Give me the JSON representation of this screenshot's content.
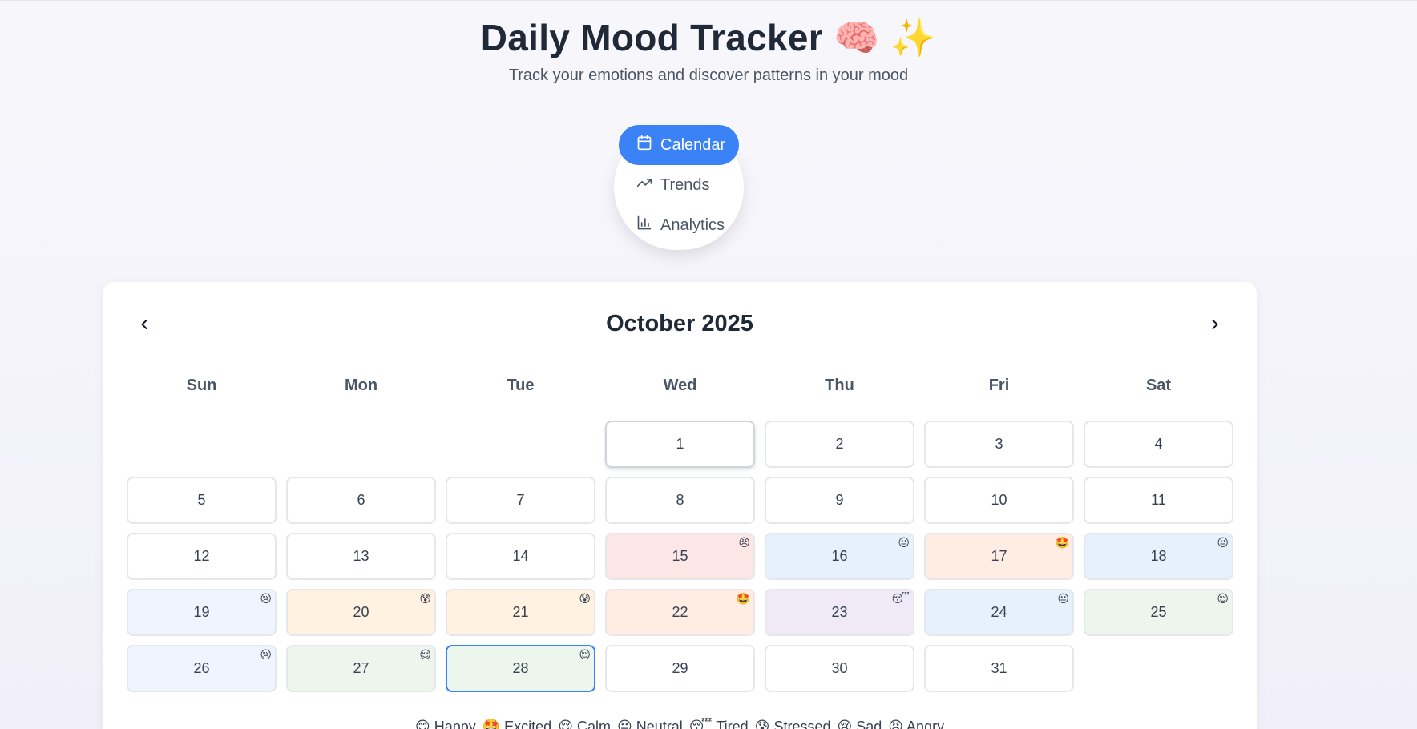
{
  "header": {
    "title": "Daily Mood Tracker 🧠 ✨",
    "subtitle": "Track your emotions and discover patterns in your mood"
  },
  "nav": {
    "items": [
      {
        "label": "Calendar",
        "icon": "calendar-icon",
        "active": true
      },
      {
        "label": "Trends",
        "icon": "trending-up-icon",
        "active": false
      },
      {
        "label": "Analytics",
        "icon": "bar-chart-icon",
        "active": false
      }
    ]
  },
  "calendar": {
    "month_label": "October 2025",
    "weekdays": [
      "Sun",
      "Mon",
      "Tue",
      "Wed",
      "Thu",
      "Fri",
      "Sat"
    ],
    "first_weekday_index": 3,
    "today": 1,
    "selected": 28,
    "days": [
      {
        "day": "1",
        "mood": null
      },
      {
        "day": "2",
        "mood": null
      },
      {
        "day": "3",
        "mood": null
      },
      {
        "day": "4",
        "mood": null
      },
      {
        "day": "5",
        "mood": null
      },
      {
        "day": "6",
        "mood": null
      },
      {
        "day": "7",
        "mood": null
      },
      {
        "day": "8",
        "mood": null
      },
      {
        "day": "9",
        "mood": null
      },
      {
        "day": "10",
        "mood": null
      },
      {
        "day": "11",
        "mood": null
      },
      {
        "day": "12",
        "mood": null
      },
      {
        "day": "13",
        "mood": null
      },
      {
        "day": "14",
        "mood": null
      },
      {
        "day": "15",
        "mood": "angry"
      },
      {
        "day": "16",
        "mood": "neutral"
      },
      {
        "day": "17",
        "mood": "excited"
      },
      {
        "day": "18",
        "mood": "neutral"
      },
      {
        "day": "19",
        "mood": "sad"
      },
      {
        "day": "20",
        "mood": "stressed"
      },
      {
        "day": "21",
        "mood": "stressed"
      },
      {
        "day": "22",
        "mood": "excited"
      },
      {
        "day": "23",
        "mood": "tired"
      },
      {
        "day": "24",
        "mood": "neutral"
      },
      {
        "day": "25",
        "mood": "calm"
      },
      {
        "day": "26",
        "mood": "sad"
      },
      {
        "day": "27",
        "mood": "calm"
      },
      {
        "day": "28",
        "mood": "calm"
      },
      {
        "day": "29",
        "mood": null
      },
      {
        "day": "30",
        "mood": null
      },
      {
        "day": "31",
        "mood": null
      }
    ]
  },
  "moods": {
    "happy": {
      "emoji": "😊",
      "label": "Happy",
      "color": "#fef9c3"
    },
    "excited": {
      "emoji": "🤩",
      "label": "Excited",
      "color": "#ffede3"
    },
    "calm": {
      "emoji": "😌",
      "label": "Calm",
      "color": "#ecf6ec"
    },
    "neutral": {
      "emoji": "😐",
      "label": "Neutral",
      "color": "#e7f1fd"
    },
    "tired": {
      "emoji": "😴",
      "label": "Tired",
      "color": "#f0e9f6"
    },
    "stressed": {
      "emoji": "😰",
      "label": "Stressed",
      "color": "#fff2e0"
    },
    "sad": {
      "emoji": "😢",
      "label": "Sad",
      "color": "#eef5fe"
    },
    "angry": {
      "emoji": "😠",
      "label": "Angry",
      "color": "#fce6e6"
    }
  },
  "legend": [
    "happy",
    "excited",
    "calm",
    "neutral",
    "tired",
    "stressed",
    "sad",
    "angry"
  ],
  "colors": {
    "accent": "#3b82f6",
    "border": "#e5e7eb",
    "title": "#1f2937"
  }
}
